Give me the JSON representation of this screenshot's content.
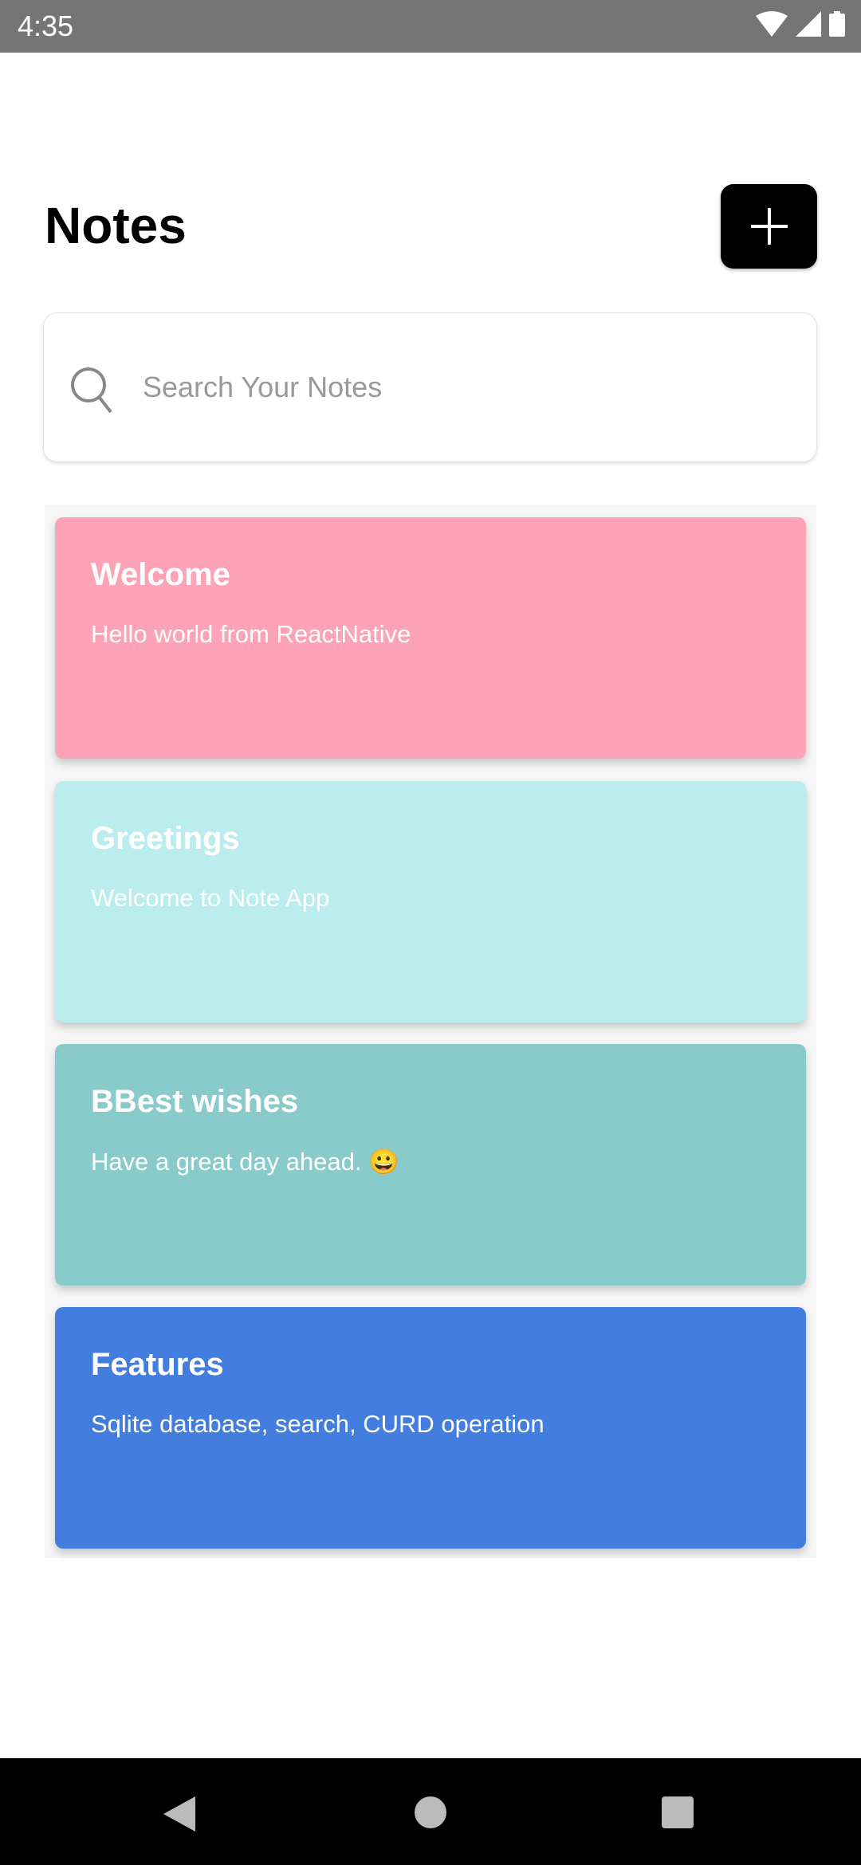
{
  "status_bar": {
    "time": "4:35"
  },
  "header": {
    "title": "Notes",
    "add_button": "plus-icon"
  },
  "search": {
    "placeholder": "Search Your Notes",
    "value": ""
  },
  "notes": [
    {
      "title": "Welcome",
      "body": "Hello world from ReactNative",
      "color": "#FCA3B7"
    },
    {
      "title": "Greetings",
      "body": "Welcome to Note App",
      "color": "#BBEDEE"
    },
    {
      "title": "BBest wishes",
      "body": "Have a great day ahead. 😀",
      "color": "#89CBCA"
    },
    {
      "title": "Features",
      "body": "Sqlite database, search, CURD operation",
      "color": "#437DDE"
    }
  ]
}
